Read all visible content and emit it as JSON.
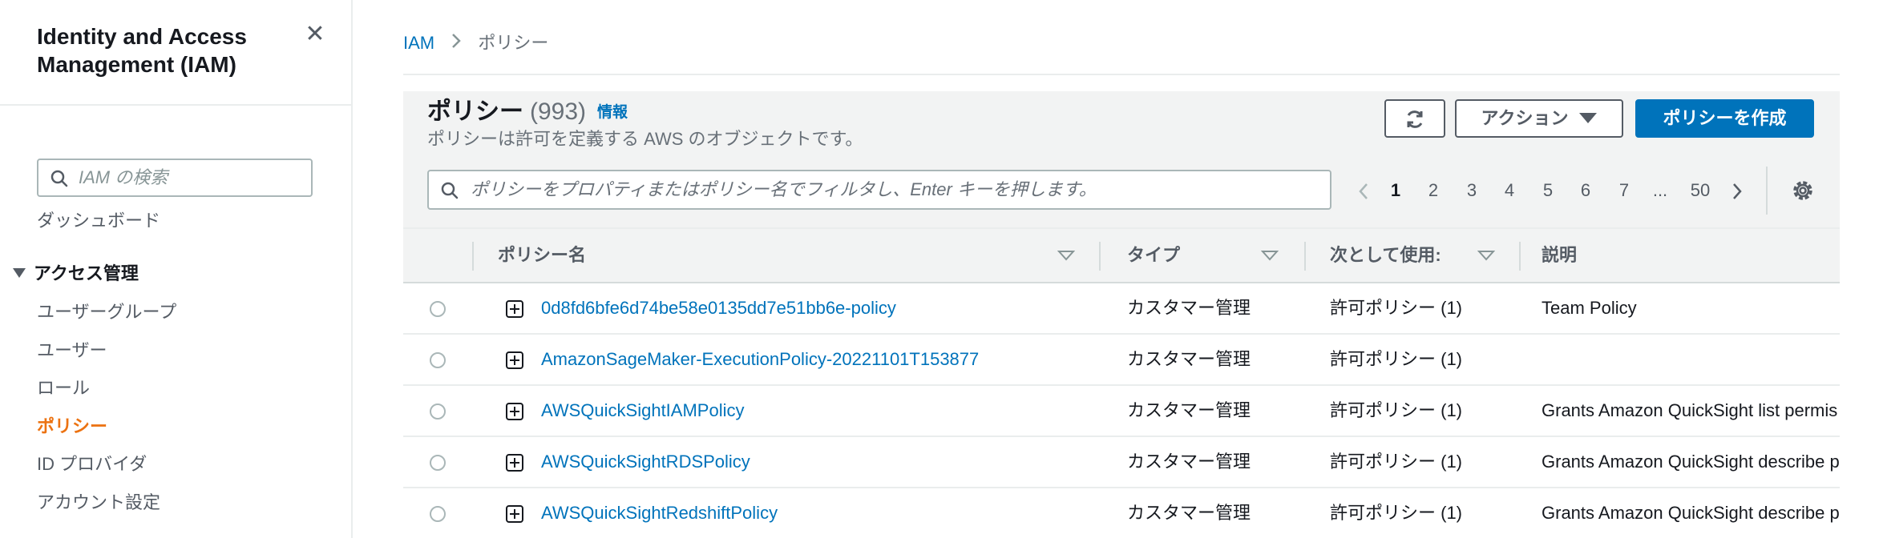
{
  "sidebar": {
    "title_line1": "Identity and Access",
    "title_line2": "Management (IAM)",
    "search_placeholder": "IAM の検索",
    "dashboard": "ダッシュボード",
    "access_section": "アクセス管理",
    "items": [
      {
        "label": "ユーザーグループ"
      },
      {
        "label": "ユーザー"
      },
      {
        "label": "ロール"
      },
      {
        "label": "ポリシー"
      },
      {
        "label": "ID プロバイダ"
      },
      {
        "label": "アカウント設定"
      }
    ]
  },
  "breadcrumb": {
    "root": "IAM",
    "current": "ポリシー"
  },
  "header": {
    "title": "ポリシー",
    "count": "(993)",
    "info": "情報",
    "description": "ポリシーは許可を定義する AWS のオブジェクトです。",
    "actions_label": "アクション",
    "create_label": "ポリシーを作成"
  },
  "filter": {
    "placeholder": "ポリシーをプロパティまたはポリシー名でフィルタし、Enter キーを押します。"
  },
  "pagination": {
    "pages": [
      "1",
      "2",
      "3",
      "4",
      "5",
      "6",
      "7",
      "...",
      "50"
    ],
    "current": "1"
  },
  "table": {
    "columns": {
      "name": "ポリシー名",
      "type": "タイプ",
      "used_as": "次として使用:",
      "description": "説明"
    },
    "rows": [
      {
        "name": "0d8fd6bfe6d74be58e0135dd7e51bb6e-policy",
        "type": "カスタマー管理",
        "used_as": "許可ポリシー (1)",
        "description": "Team Policy"
      },
      {
        "name": "AmazonSageMaker-ExecutionPolicy-20221101T153877",
        "type": "カスタマー管理",
        "used_as": "許可ポリシー (1)",
        "description": ""
      },
      {
        "name": "AWSQuickSightIAMPolicy",
        "type": "カスタマー管理",
        "used_as": "許可ポリシー (1)",
        "description": "Grants Amazon QuickSight list permis"
      },
      {
        "name": "AWSQuickSightRDSPolicy",
        "type": "カスタマー管理",
        "used_as": "許可ポリシー (1)",
        "description": "Grants Amazon QuickSight describe p"
      },
      {
        "name": "AWSQuickSightRedshiftPolicy",
        "type": "カスタマー管理",
        "used_as": "許可ポリシー (1)",
        "description": "Grants Amazon QuickSight describe p"
      }
    ]
  },
  "colors": {
    "link": "#0073bb",
    "active_nav": "#ec7211",
    "primary_button": "#0073bb",
    "header_bg": "#f2f3f3"
  },
  "icons": [
    "close-icon",
    "search-icon",
    "caret-down-icon",
    "refresh-icon",
    "chevron-left-icon",
    "chevron-right-icon",
    "settings-gear-icon",
    "sort-down-icon",
    "expand-plus-icon"
  ]
}
